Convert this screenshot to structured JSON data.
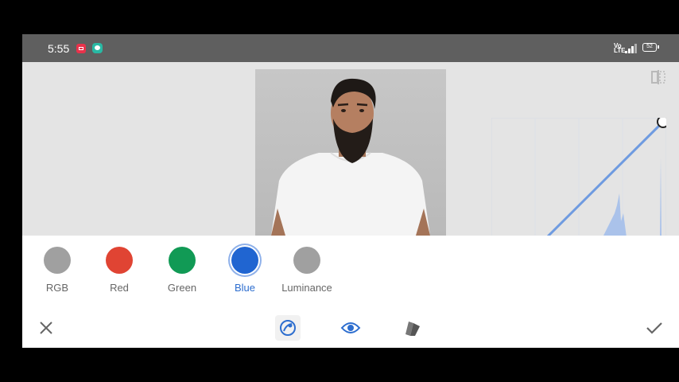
{
  "status_bar": {
    "time": "5:55",
    "network_label": "Vo\nLTE",
    "battery_level": "52",
    "notification_icons": [
      "screen-record-icon",
      "chat-icon"
    ]
  },
  "editor": {
    "compare_icon": "compare-icon",
    "curve_accent": "#6f9be0"
  },
  "channels": [
    {
      "label": "RGB",
      "color": "#a0a0a0"
    },
    {
      "label": "Red",
      "color": "#e04433"
    },
    {
      "label": "Green",
      "color": "#119a55"
    },
    {
      "label": "Blue",
      "color": "#2065d1",
      "selected": true
    },
    {
      "label": "Luminance",
      "color": "#a0a0a0"
    }
  ],
  "toolbar": {
    "cancel_icon": "close-icon",
    "curves_icon": "curves-icon",
    "preview_icon": "eye-icon",
    "styles_icon": "styles-icon",
    "apply_icon": "checkmark-icon"
  }
}
